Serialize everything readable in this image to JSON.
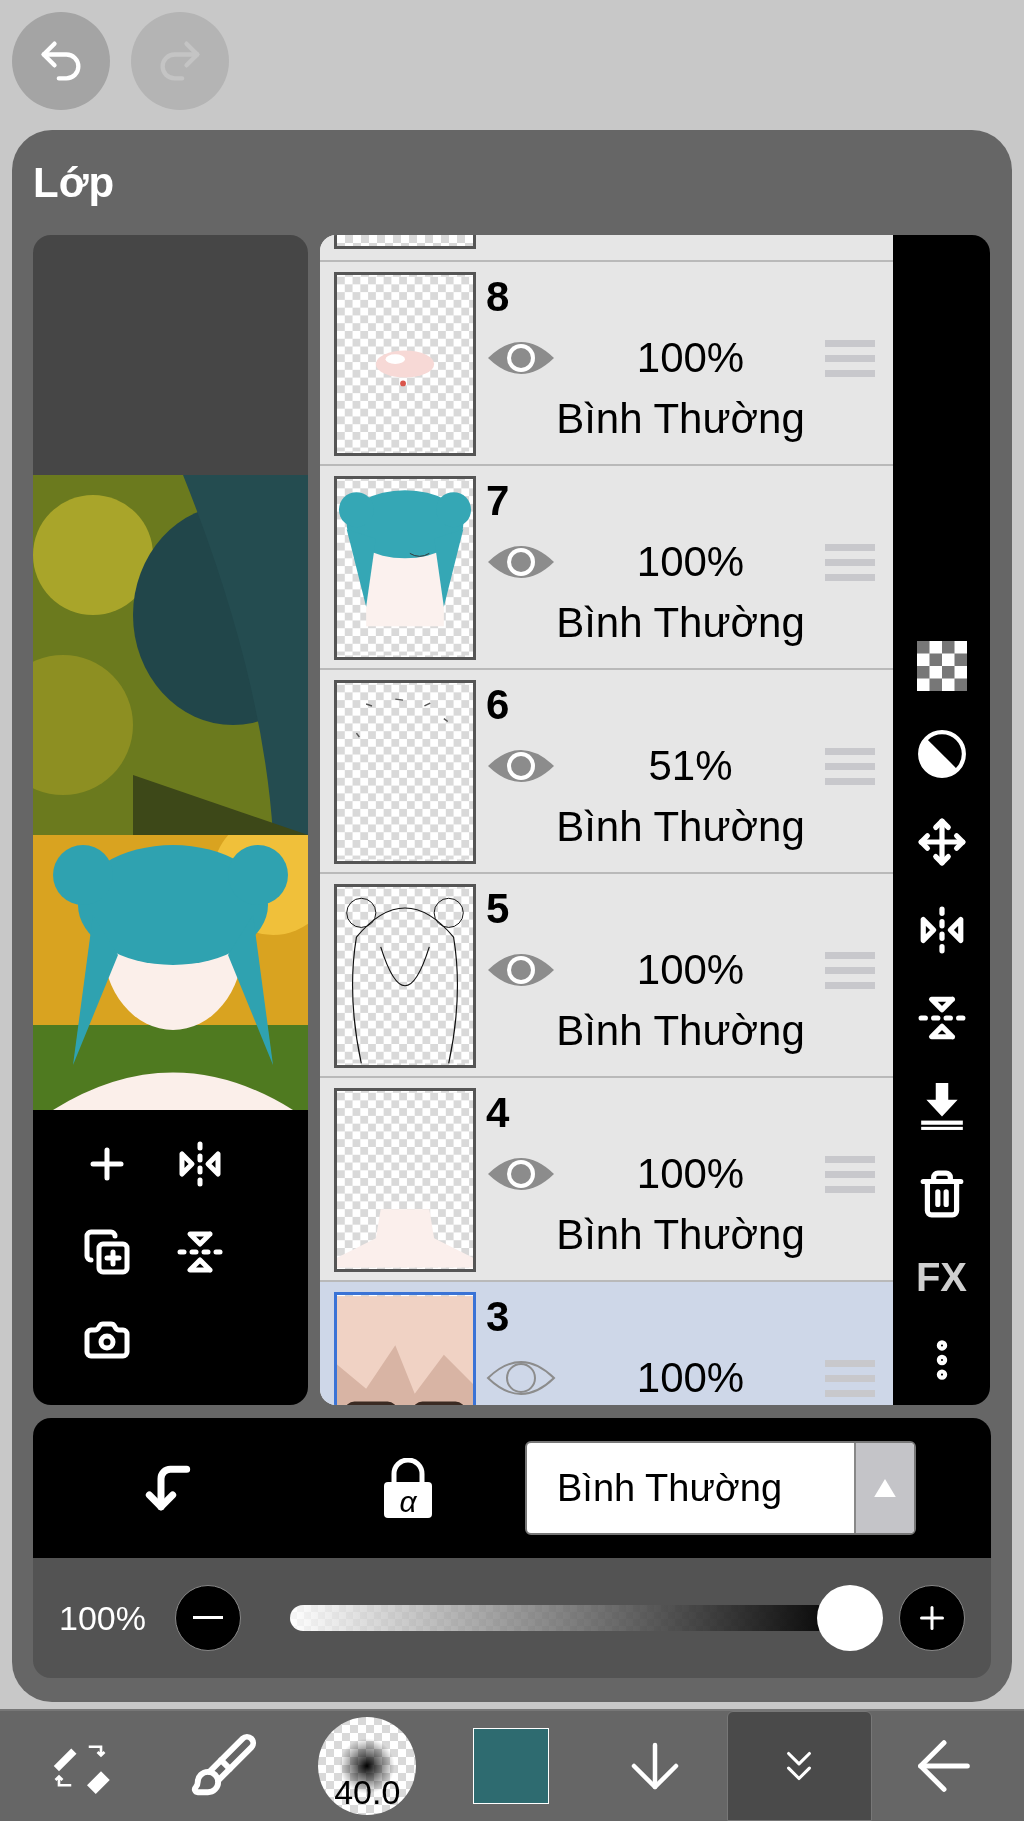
{
  "history": [
    {
      "kind": "undo",
      "disabled": false
    },
    {
      "kind": "redo",
      "disabled": true
    }
  ],
  "panel": {
    "title": "Lớp"
  },
  "canvas_tools": [
    {
      "kind": "add"
    },
    {
      "kind": "flip_h"
    },
    {
      "kind": "add_copy"
    },
    {
      "kind": "flip_v"
    },
    {
      "kind": "camera"
    }
  ],
  "layers": [
    {
      "number": "8",
      "visible": true,
      "opacity": "100%",
      "blend": "Bình Thường",
      "selected": false
    },
    {
      "number": "7",
      "visible": true,
      "opacity": "100%",
      "blend": "Bình Thường",
      "selected": false
    },
    {
      "number": "6",
      "visible": true,
      "opacity": "51%",
      "blend": "Bình Thường",
      "selected": false
    },
    {
      "number": "5",
      "visible": true,
      "opacity": "100%",
      "blend": "Bình Thường",
      "selected": false
    },
    {
      "number": "4",
      "visible": true,
      "opacity": "100%",
      "blend": "Bình Thường",
      "selected": false
    },
    {
      "number": "3",
      "visible": false,
      "opacity": "100%",
      "selected": true
    }
  ],
  "layer_tools": [
    {
      "kind": "checker"
    },
    {
      "kind": "half"
    },
    {
      "kind": "move"
    },
    {
      "kind": "flip_h"
    },
    {
      "kind": "flip_v"
    },
    {
      "kind": "merge"
    },
    {
      "kind": "trash"
    },
    {
      "kind": "fx",
      "label": "FX"
    },
    {
      "kind": "more"
    }
  ],
  "blend_bar": {
    "alpha_label": "α",
    "blend_mode": "Bình Thường"
  },
  "opacity": {
    "reading": "100%",
    "level": 1
  },
  "toolbar": [
    {
      "kind": "swap",
      "selected": false
    },
    {
      "kind": "brush",
      "selected": false
    },
    {
      "kind": "size",
      "label": "40.0",
      "selected": false
    },
    {
      "kind": "color",
      "color": "#2e6b70",
      "selected": false
    },
    {
      "kind": "down",
      "selected": false
    },
    {
      "kind": "collapse",
      "selected": true
    },
    {
      "kind": "back",
      "selected": false
    }
  ]
}
